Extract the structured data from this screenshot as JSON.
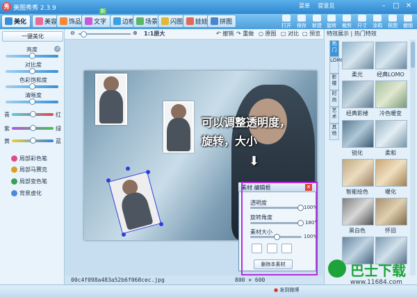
{
  "window": {
    "title": "美图秀秀 2.3.9",
    "top_menu": [
      "菜单",
      "提意见"
    ],
    "min_icon": "minimize-icon",
    "max_icon": "maximize-icon",
    "close_icon": "close-icon"
  },
  "tabs": [
    {
      "label": "美化",
      "icon": "beautify-icon",
      "color": "#3a8fd6",
      "active": true
    },
    {
      "label": "美容",
      "icon": "makeup-icon",
      "color": "#e86b9a"
    },
    {
      "label": "饰品",
      "icon": "accessory-icon",
      "color": "#f08a3a"
    },
    {
      "label": "文字",
      "icon": "text-icon",
      "color": "#c45cd8",
      "badge": "新"
    },
    {
      "label": "边框",
      "icon": "frame-icon",
      "color": "#3aa0e0"
    },
    {
      "label": "场景",
      "icon": "scene-icon",
      "color": "#5ab66a"
    },
    {
      "label": "闪图",
      "icon": "flash-icon",
      "color": "#e0b83a"
    },
    {
      "label": "娃娃",
      "icon": "doll-icon",
      "color": "#e06a5a"
    },
    {
      "label": "拼图",
      "icon": "collage-icon",
      "color": "#4a86d0"
    }
  ],
  "right_tools": [
    "打开",
    "保存",
    "新建",
    "旋转",
    "裁剪",
    "尺寸",
    "涂鸦",
    "抠图",
    "撤销"
  ],
  "left_panel": {
    "one_click": "一键美化",
    "sliders": [
      {
        "label": "亮度",
        "value": 0.5
      },
      {
        "label": "对比度",
        "value": 0.5
      },
      {
        "label": "色彩饱和度",
        "value": 0.5
      },
      {
        "label": "清晰度",
        "value": 0.5
      }
    ],
    "color_sliders": [
      {
        "left": "青",
        "right": "红",
        "value": 0.55
      },
      {
        "left": "紫",
        "right": "绿",
        "value": 0.55
      },
      {
        "left": "黄",
        "right": "蓝",
        "value": 0.55
      }
    ],
    "tools": [
      {
        "label": "局部彩色笔",
        "icon": "color-pen-icon",
        "color": "#e04a8a"
      },
      {
        "label": "局部马赛克",
        "icon": "mosaic-icon",
        "color": "#d8a020"
      },
      {
        "label": "局部变色笔",
        "icon": "recolor-pen-icon",
        "color": "#3aa050"
      },
      {
        "label": "背景虚化",
        "icon": "blur-bg-icon",
        "color": "#4a8ad8"
      }
    ]
  },
  "center_toolbar": {
    "zoom_label": "1:1原大",
    "items": [
      "撤销",
      "重做",
      "原图",
      "对比",
      "预览"
    ]
  },
  "annotation": {
    "line1": "可以调整透明度，",
    "line2": "旋转，大小",
    "arrow": "⬇"
  },
  "material_panel": {
    "title": "素材 编辑框",
    "close": "✕",
    "rows": [
      {
        "label": "透明度",
        "value_text": "100%",
        "value": 1.0
      },
      {
        "label": "旋转角度",
        "value_text": "180°",
        "value": 0.5
      },
      {
        "label": "素材大小",
        "value_text": "100%",
        "value": 0.5
      }
    ],
    "delete_label": "删除本素材",
    "button_icons": [
      "flip-horizontal-icon",
      "flip-vertical-icon",
      "layer-icon"
    ]
  },
  "right_panel": {
    "header": "特效展示 | 热门特效",
    "vertical_tabs": [
      "热门",
      "LOMO",
      "影楼",
      "时尚",
      "艺术",
      "其他"
    ],
    "effects": [
      "柔光",
      "经典LOMO",
      "经典影楼",
      "冷色暖变",
      "锐化",
      "柔和",
      "智能绘色",
      "暖化",
      "黑白色",
      "怀旧",
      "",
      ""
    ]
  },
  "status": {
    "filename": "00c4f098a483a52b6f068cec.jpg",
    "dims": "800 × 600",
    "share": "发到微博"
  },
  "watermark": {
    "text": "巴士下载",
    "url": "www.11684.com"
  }
}
